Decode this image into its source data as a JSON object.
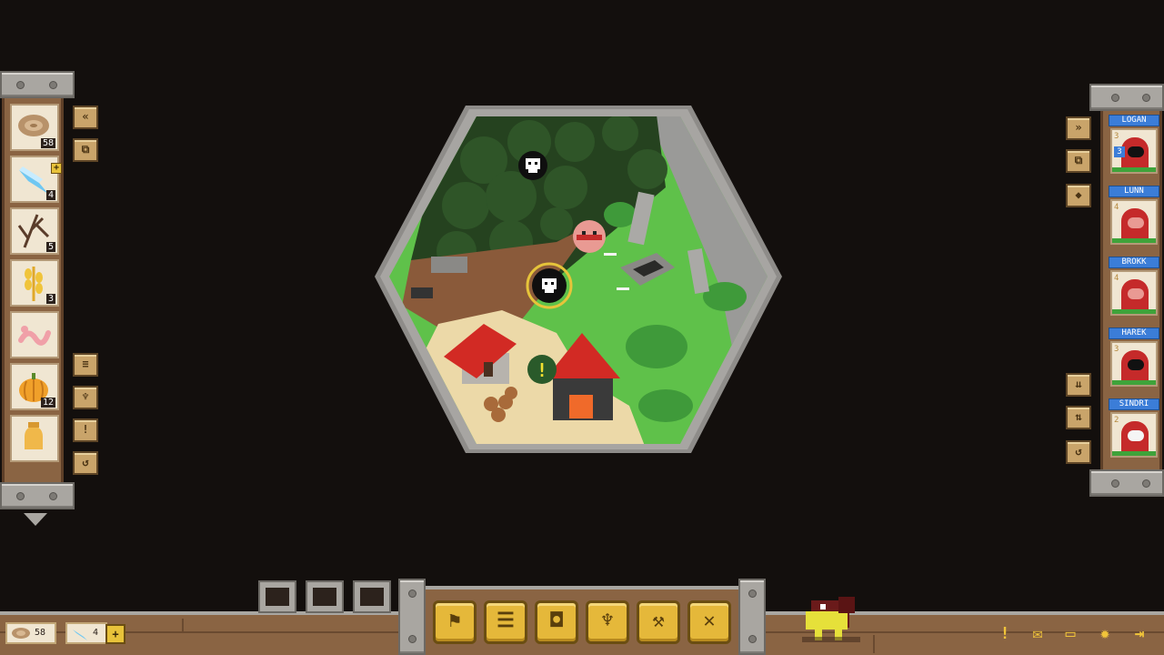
{
  "inventory": {
    "items": [
      {
        "icon": "wood-log-icon",
        "count": "58",
        "plus": false
      },
      {
        "icon": "crystal-icon",
        "count": "4",
        "plus": true
      },
      {
        "icon": "twig-icon",
        "count": "5",
        "plus": false
      },
      {
        "icon": "wheat-icon",
        "count": "3",
        "plus": false
      },
      {
        "icon": "worm-icon",
        "count": "",
        "plus": false
      },
      {
        "icon": "pumpkin-icon",
        "count": "12",
        "plus": false
      },
      {
        "icon": "honey-icon",
        "count": "",
        "plus": false
      }
    ],
    "side_buttons_top": [
      "«",
      "⧉"
    ],
    "side_buttons_bottom": [
      "≡",
      "♆",
      "!",
      "↺"
    ]
  },
  "roster": {
    "units": [
      {
        "name": "LOGAN",
        "level": "3",
        "face": "black",
        "badge": "3"
      },
      {
        "name": "LUNN",
        "level": "4",
        "face": "pink",
        "badge": ""
      },
      {
        "name": "BROKK",
        "level": "4",
        "face": "pink",
        "badge": ""
      },
      {
        "name": "HAREK",
        "level": "3",
        "face": "black",
        "badge": ""
      },
      {
        "name": "SINDRI",
        "level": "2",
        "face": "white",
        "badge": ""
      }
    ],
    "side_buttons_top": [
      "»",
      "⧉",
      "◆"
    ],
    "side_buttons_bottom": [
      "⇊",
      "⇅",
      "↺"
    ]
  },
  "resources": {
    "wood": "58",
    "crystal": "4",
    "plus": "+"
  },
  "toolbar": {
    "buttons": [
      {
        "name": "flag-button",
        "glyph": "⚑"
      },
      {
        "name": "scroll-button",
        "glyph": "☰"
      },
      {
        "name": "mug-button",
        "glyph": "◘"
      },
      {
        "name": "trophy-button",
        "glyph": "♆"
      },
      {
        "name": "pickaxe-button",
        "glyph": "⚒"
      },
      {
        "name": "swords-button",
        "glyph": "✕"
      }
    ]
  },
  "system_icons": [
    {
      "name": "alert-icon",
      "glyph": "!"
    },
    {
      "name": "mail-icon",
      "glyph": "✉"
    },
    {
      "name": "monitor-icon",
      "glyph": "▭"
    },
    {
      "name": "settings-gear-icon",
      "glyph": "✹"
    },
    {
      "name": "exit-icon",
      "glyph": "⇥"
    }
  ],
  "map": {
    "alert_marker": "!",
    "colors": {
      "grass": "#5fc14a",
      "dark_grass": "#3f9a3a",
      "forest": "#25421f",
      "sand": "#ecd9a8",
      "dirt": "#8a5a3a",
      "stone": "#9a9a98",
      "roof": "#d22a24"
    }
  }
}
